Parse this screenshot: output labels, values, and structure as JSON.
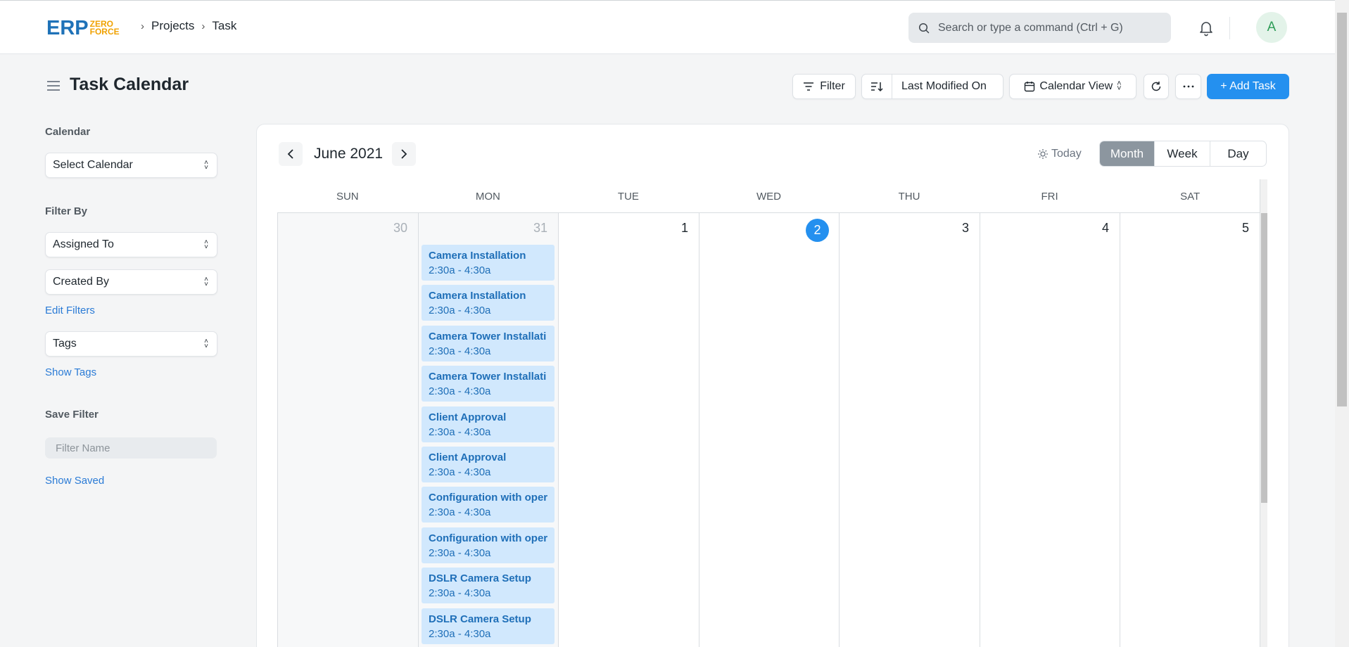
{
  "app": {
    "logo_text": "ERP",
    "logo_sub_1": "ZERO",
    "logo_sub_2": "FORCE"
  },
  "breadcrumb": [
    "Projects",
    "Task"
  ],
  "search": {
    "placeholder": "Search or type a command (Ctrl + G)"
  },
  "user": {
    "avatar_initial": "A"
  },
  "page": {
    "title": "Task Calendar"
  },
  "toolbar": {
    "filter_label": "Filter",
    "sort_label": "Last Modified On",
    "view_label": "Calendar View",
    "add_label": "+ Add Task"
  },
  "sidebar": {
    "calendar_label": "Calendar",
    "calendar_select": "Select Calendar",
    "filter_by_label": "Filter By",
    "assigned_to": "Assigned To",
    "created_by": "Created By",
    "edit_filters": "Edit Filters",
    "tags": "Tags",
    "show_tags": "Show Tags",
    "save_filter_label": "Save Filter",
    "filter_name_placeholder": "Filter Name",
    "show_saved": "Show Saved"
  },
  "calendar": {
    "title": "June 2021",
    "today_label": "Today",
    "views": [
      "Month",
      "Week",
      "Day"
    ],
    "active_view": "Month",
    "weekdays": [
      "SUN",
      "MON",
      "TUE",
      "WED",
      "THU",
      "FRI",
      "SAT"
    ],
    "days": [
      "30",
      "31",
      "1",
      "2",
      "3",
      "4",
      "5"
    ],
    "today_day": "2",
    "events": [
      {
        "title": "Camera Installation",
        "time": "2:30a - 4:30a"
      },
      {
        "title": "Camera Installation",
        "time": "2:30a - 4:30a"
      },
      {
        "title": "Camera Tower Installati",
        "time": "2:30a - 4:30a"
      },
      {
        "title": "Camera Tower Installati",
        "time": "2:30a - 4:30a"
      },
      {
        "title": "Client Approval",
        "time": "2:30a - 4:30a"
      },
      {
        "title": "Client Approval",
        "time": "2:30a - 4:30a"
      },
      {
        "title": "Configuration with oper",
        "time": "2:30a - 4:30a"
      },
      {
        "title": "Configuration with oper",
        "time": "2:30a - 4:30a"
      },
      {
        "title": "DSLR Camera Setup",
        "time": "2:30a - 4:30a"
      },
      {
        "title": "DSLR Camera Setup",
        "time": "2:30a - 4:30a"
      }
    ]
  },
  "colors": {
    "primary": "#2490ef",
    "event_bg": "#d1e8fd",
    "event_text": "#1f6fb8",
    "link": "#2a7bd6"
  }
}
